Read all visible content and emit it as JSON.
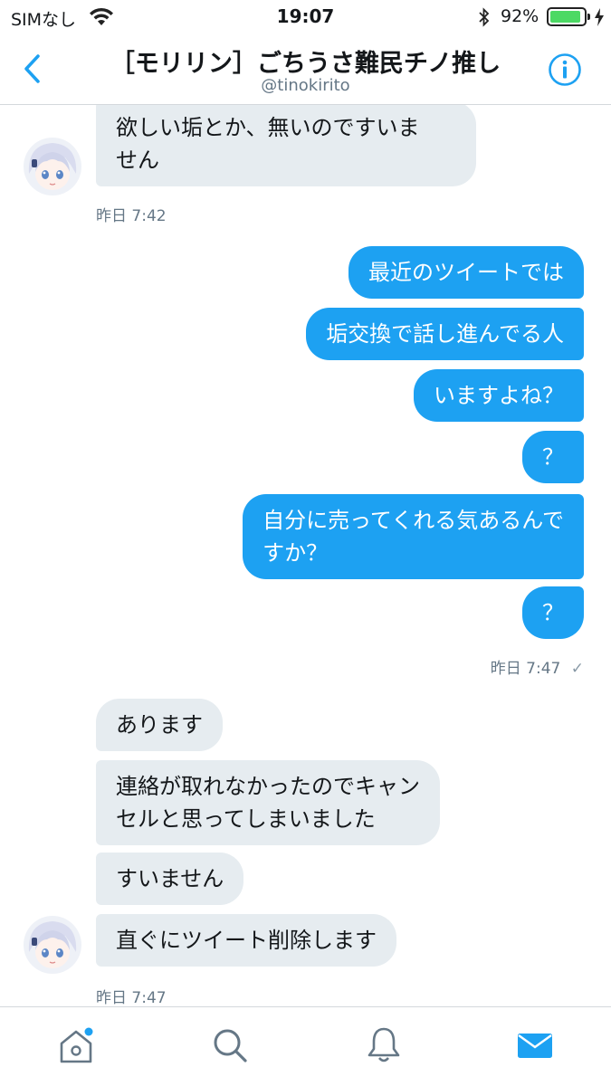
{
  "status_bar": {
    "carrier": "SIMなし",
    "time": "19:07",
    "battery": "92%",
    "battery_level": 0.92,
    "icons": [
      "wifi-icon",
      "bluetooth-icon",
      "battery-icon",
      "charging-bolt-icon"
    ]
  },
  "header": {
    "title": "［モリリン］ごちうさ難民チノ推し",
    "handle": "@tinokirito",
    "icons": [
      "back-chevron-icon",
      "info-icon"
    ]
  },
  "messages": [
    {
      "side": "received",
      "text": [
        "欲しい垢とか、無いのですいま",
        "せん"
      ]
    },
    {
      "timestamp": "昨日 7:42"
    },
    {
      "side": "sent",
      "text": [
        "最近のツイートでは"
      ]
    },
    {
      "side": "sent",
      "text": [
        "垢交換で話し進んでる人"
      ]
    },
    {
      "side": "sent",
      "text": [
        "いますよね？"
      ]
    },
    {
      "side": "sent",
      "text": [
        "？"
      ]
    },
    {
      "side": "sent",
      "text": [
        "自分に売ってくれる気あるんで",
        "すか？"
      ]
    },
    {
      "side": "sent",
      "text": [
        "？"
      ]
    },
    {
      "timestamp": "昨日 7:47",
      "read_mark": "✓"
    },
    {
      "side": "received",
      "text": [
        "あります"
      ]
    },
    {
      "side": "received",
      "text": [
        "連絡が取れなかったのでキャン",
        "セルと思ってしまいました"
      ]
    },
    {
      "side": "received",
      "text": [
        "すいません"
      ]
    },
    {
      "side": "received",
      "text": [
        "直ぐにツイート削除します"
      ]
    },
    {
      "timestamp": "昨日 7:47"
    }
  ],
  "tabbar": {
    "tabs": [
      "home-icon",
      "search-icon",
      "notifications-icon",
      "messages-icon"
    ],
    "active": "messages-icon",
    "accent": "#1da1f2"
  },
  "colors": {
    "accent": "#1da1f2",
    "received_bubble": "#e6ecf0",
    "secondary_text": "#657786"
  }
}
